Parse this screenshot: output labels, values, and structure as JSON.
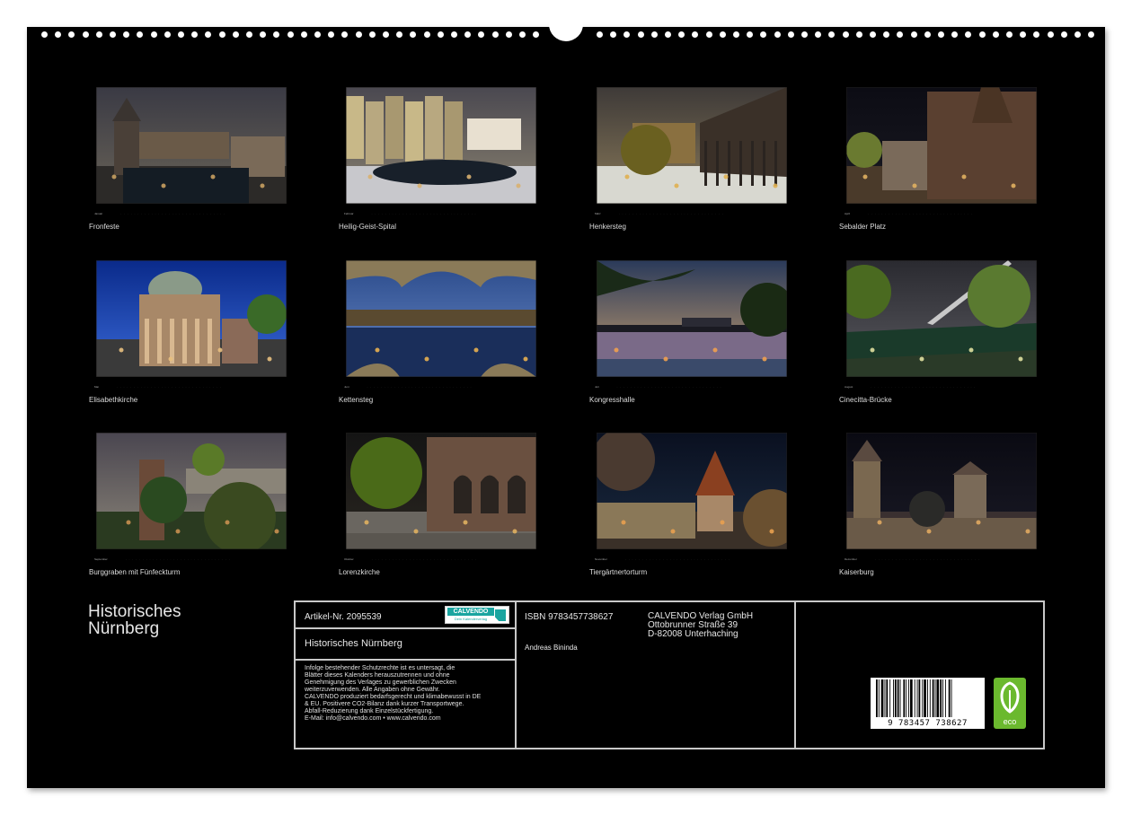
{
  "calendar": {
    "title_line1": "Historisches",
    "title_line2": "Nürnberg"
  },
  "months": [
    {
      "month": "Januar",
      "caption": "Fronfeste"
    },
    {
      "month": "Februar",
      "caption": "Heilig-Geist-Spital"
    },
    {
      "month": "März",
      "caption": "Henkersteg"
    },
    {
      "month": "April",
      "caption": "Sebalder Platz"
    },
    {
      "month": "Mai",
      "caption": "Elisabethkirche"
    },
    {
      "month": "Juni",
      "caption": "Kettensteg"
    },
    {
      "month": "Juli",
      "caption": "Kongresshalle"
    },
    {
      "month": "August",
      "caption": "Cinecitta-Brücke"
    },
    {
      "month": "September",
      "caption": "Burggraben mit Fünfeckturm"
    },
    {
      "month": "Oktober",
      "caption": "Lorenzkirche"
    },
    {
      "month": "November",
      "caption": "Tiergärtnertorturm"
    },
    {
      "month": "Dezember",
      "caption": "Kaiserburg"
    }
  ],
  "info": {
    "article_no": "Artikel-Nr. 2095539",
    "logo_brand": "CALVENDO",
    "logo_tagline": "Dein Kalenderverlag",
    "title": "Historisches Nürnberg",
    "isbn": "ISBN 9783457738627",
    "author": "Andreas Bininda",
    "publisher_line1": "CALVENDO Verlag GmbH",
    "publisher_line2": "Ottobrunner Straße 39",
    "publisher_line3": "D-82008 Unterhaching",
    "legal_lines": [
      "Infolge bestehender Schutzrechte ist es untersagt, die",
      "Blätter dieses Kalenders herauszutrennen und ohne",
      "Genehmigung des Verlages zu gewerblichen Zwecken",
      "weiterzuverwenden. Alle Angaben ohne Gewähr.",
      "CALVENDO produziert bedarfsgerecht und klimabewusst in DE",
      "& EU. Positivere CO2-Bilanz dank kurzer Transportwege.",
      "Abfall-Reduzierung dank Einzelstückfertigung.",
      "E-Mail: info@calvendo.com • www.calvendo.com"
    ],
    "barcode_digits": "9 783457 738627",
    "eco_label": "eco"
  },
  "colors": {
    "background": "#000000",
    "text": "#e6e6e6",
    "frame": "#c8c8c8",
    "brand_teal": "#1aa5a0",
    "eco_green": "#6bb92e"
  }
}
